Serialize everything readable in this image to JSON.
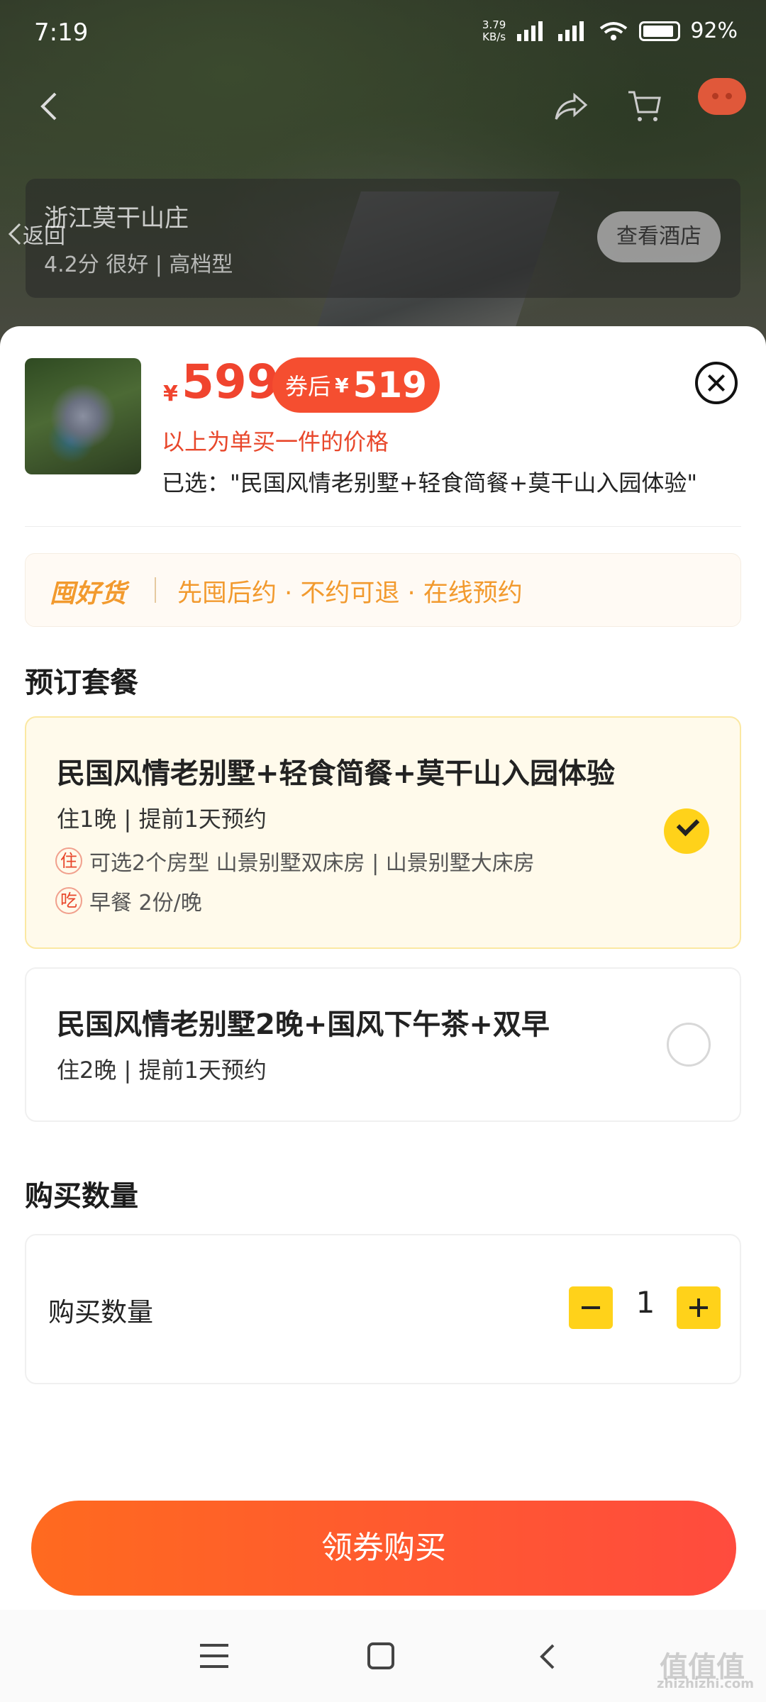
{
  "status_bar": {
    "time": "7:19",
    "net_speed_value": "3.79",
    "net_speed_unit": "KB/s",
    "battery": "92%"
  },
  "top_nav": {
    "icons": [
      "back-icon",
      "share-icon",
      "cart-icon",
      "message-icon"
    ]
  },
  "hotel": {
    "name": "浙江莫干山庄",
    "back_label": "返回",
    "rating": "4.2分 很好 | 高档型",
    "view_button": "查看酒店"
  },
  "sheet": {
    "price_currency": "¥",
    "price": "599",
    "coupon_label": "券后",
    "coupon_currency": "¥",
    "coupon_price": "519",
    "price_note": "以上为单买一件的价格",
    "selected": "已选：\"民国风情老别墅+轻食简餐+莫干山入园体验\""
  },
  "guarantee": {
    "brand": "囤好货",
    "text": "先囤后约 · 不约可退 · 在线预约"
  },
  "packages": {
    "section_title": "预订套餐",
    "items": [
      {
        "title": "民国风情老别墅+轻食简餐+莫干山入园体验",
        "subtitle": "住1晚 | 提前1天预约",
        "stay_tag": "住",
        "stay_text": "可选2个房型 山景别墅双床房 | 山景别墅大床房",
        "food_tag": "吃",
        "food_text": "早餐  2份/晚",
        "selected": true
      },
      {
        "title": "民国风情老别墅2晚+国风下午茶+双早",
        "subtitle": "住2晚 | 提前1天预约",
        "selected": false
      }
    ]
  },
  "quantity": {
    "section_title": "购买数量",
    "label": "购买数量",
    "value": "1"
  },
  "buy_button": "领券购买",
  "watermark": {
    "logo": "值值值",
    "domain": "zhizhizhi.com"
  },
  "colors": {
    "accent": "#f0442e",
    "coupon": "#f54e30",
    "highlight": "#ffd21a",
    "guarantee": "#f29a2e"
  }
}
